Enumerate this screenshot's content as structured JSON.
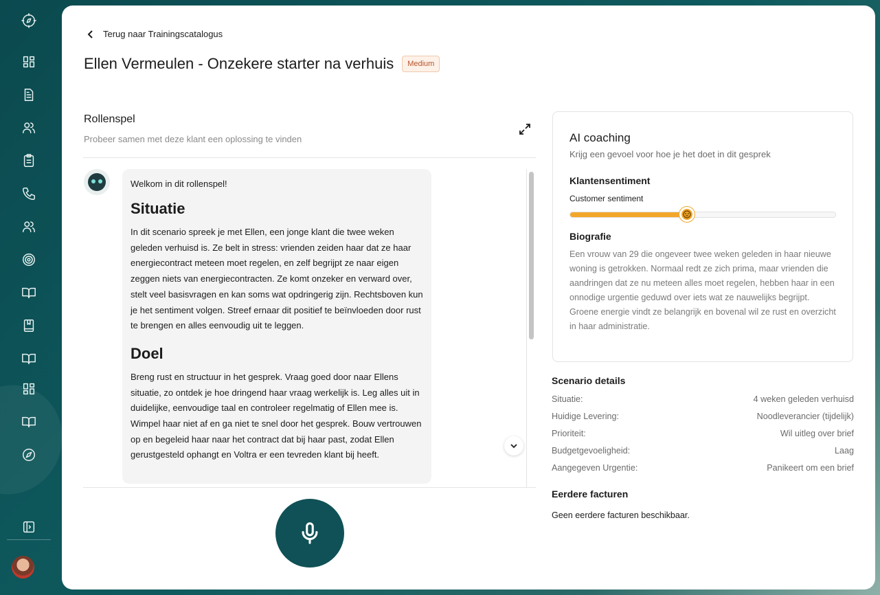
{
  "sidebar": {
    "icons": [
      "compass-logo-icon",
      "dashboard-icon",
      "document-icon",
      "users-icon",
      "clipboard-icon",
      "phone-icon",
      "team-icon",
      "target-icon",
      "book-open-icon",
      "book-icon",
      "book-open-icon",
      "grid-icon",
      "book-open-icon",
      "compass-icon",
      "sidebar-toggle-icon"
    ]
  },
  "header": {
    "back_label": "Terug naar Trainingscatalogus",
    "title": "Ellen Vermeulen - Onzekere starter na verhuis",
    "badge": "Medium"
  },
  "roleplay": {
    "title": "Rollenspel",
    "subtitle": "Probeer samen met deze klant een oplossing te vinden",
    "message": {
      "welcome": "Welkom in dit rollenspel!",
      "situation_heading": "Situatie",
      "situation_text": "In dit scenario spreek je met Ellen, een jonge klant die twee weken geleden verhuisd is. Ze belt in stress: vrienden zeiden haar dat ze haar energiecontract meteen moet regelen, en zelf begrijpt ze naar eigen zeggen niets van energiecontracten. Ze komt onzeker en verward over, stelt veel basisvragen en kan soms wat opdringerig zijn. Rechtsboven kun je het sentiment volgen. Streef ernaar dit positief te beïnvloeden door rust te brengen en alles eenvoudig uit te leggen.",
      "goal_heading": "Doel",
      "goal_text": "Breng rust en structuur in het gesprek. Vraag goed door naar Ellens situatie, zo ontdek je hoe dringend haar vraag werkelijk is. Leg alles uit in duidelijke, eenvoudige taal en controleer regelmatig of Ellen mee is. Wimpel haar niet af en ga niet te snel door het gesprek. Bouw vertrouwen op en begeleid haar naar het contract dat bij haar past, zodat Ellen gerustgesteld ophangt en Voltra er een tevreden klant bij heeft."
    }
  },
  "coaching": {
    "title": "AI coaching",
    "subtitle": "Krijg een gevoel voor hoe je het doet in dit gesprek",
    "sentiment_title": "Klantensentiment",
    "sentiment_label": "Customer sentiment",
    "sentiment_value": 0.44,
    "bio_title": "Biografie",
    "bio_text": "Een vrouw van 29 die ongeveer twee weken geleden in haar nieuwe woning is getrokken. Normaal redt ze zich prima, maar vrienden die aandringen dat ze nu meteen alles moet regelen, hebben haar in een onnodige urgentie geduwd over iets wat ze nauwelijks begrijpt. Groene energie vindt ze belangrijk en bovenal wil ze rust en overzicht in haar administratie."
  },
  "scenario": {
    "title": "Scenario details",
    "rows": [
      {
        "label": "Situatie:",
        "value": "4 weken geleden verhuisd"
      },
      {
        "label": "Huidige Levering:",
        "value": "Noodleverancier (tijdelijk)"
      },
      {
        "label": "Prioriteit:",
        "value": "Wil uitleg over brief"
      },
      {
        "label": "Budgetgevoeligheid:",
        "value": "Laag"
      },
      {
        "label": "Aangegeven Urgentie:",
        "value": "Panikeert om een brief"
      }
    ]
  },
  "invoices": {
    "title": "Eerdere facturen",
    "empty_text": "Geen eerdere facturen beschikbaar."
  },
  "colors": {
    "brand_dark": "#0f5156",
    "sentiment_orange": "#f2a72b",
    "badge_text": "#b5532a"
  }
}
